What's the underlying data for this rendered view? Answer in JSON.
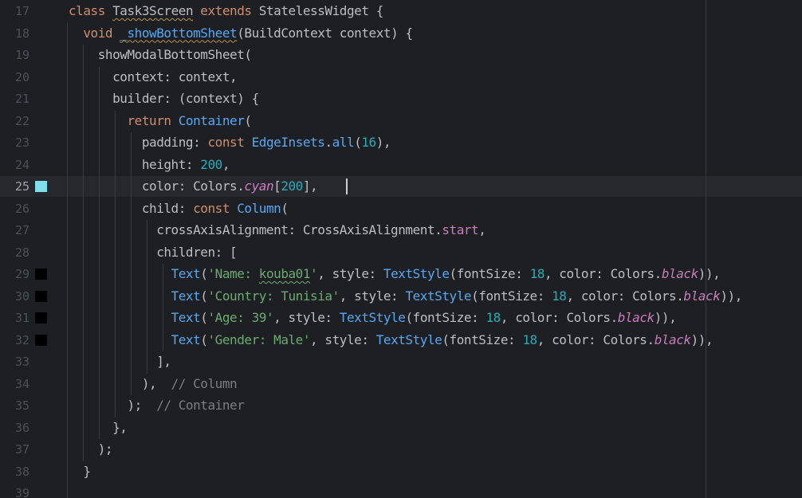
{
  "editor": {
    "current_line": "25",
    "lines": [
      {
        "num": "17",
        "tokens": [
          [
            "kw",
            "class "
          ],
          [
            "squig",
            "Task3Screen"
          ],
          [
            "kw",
            " extends "
          ],
          [
            "plain",
            "StatelessWidget {"
          ]
        ]
      },
      {
        "num": "18",
        "tokens": [
          [
            "plain",
            "  "
          ],
          [
            "kw",
            "void "
          ],
          [
            "fn-sq",
            "_showBottomSheet"
          ],
          [
            "plain",
            "(BuildContext context) {"
          ]
        ]
      },
      {
        "num": "19",
        "tokens": [
          [
            "plain",
            "    showModalBottomSheet("
          ]
        ]
      },
      {
        "num": "20",
        "tokens": [
          [
            "plain",
            "      context: context,"
          ]
        ]
      },
      {
        "num": "21",
        "tokens": [
          [
            "plain",
            "      builder: (context) {"
          ]
        ]
      },
      {
        "num": "22",
        "tokens": [
          [
            "plain",
            "        "
          ],
          [
            "kw",
            "return "
          ],
          [
            "cls",
            "Container"
          ],
          [
            "plain",
            "("
          ]
        ]
      },
      {
        "num": "23",
        "tokens": [
          [
            "plain",
            "          padding: "
          ],
          [
            "kw",
            "const "
          ],
          [
            "cls",
            "EdgeInsets"
          ],
          [
            "plain",
            "."
          ],
          [
            "fn",
            "all"
          ],
          [
            "plain",
            "("
          ],
          [
            "num",
            "16"
          ],
          [
            "plain",
            "),"
          ]
        ]
      },
      {
        "num": "24",
        "tokens": [
          [
            "plain",
            "          height: "
          ],
          [
            "num",
            "200"
          ],
          [
            "plain",
            ","
          ]
        ]
      },
      {
        "num": "25",
        "tokens": [
          [
            "plain",
            "          color: Colors."
          ],
          [
            "field",
            "cyan"
          ],
          [
            "plain",
            "["
          ],
          [
            "num",
            "200"
          ],
          [
            "plain",
            "],"
          ]
        ]
      },
      {
        "num": "26",
        "tokens": [
          [
            "plain",
            "          child: "
          ],
          [
            "kw",
            "const "
          ],
          [
            "cls",
            "Column"
          ],
          [
            "plain",
            "("
          ]
        ]
      },
      {
        "num": "27",
        "tokens": [
          [
            "plain",
            "            crossAxisAlignment: CrossAxisAlignment."
          ],
          [
            "fieldn",
            "start"
          ],
          [
            "plain",
            ","
          ]
        ]
      },
      {
        "num": "28",
        "tokens": [
          [
            "plain",
            "            children: ["
          ]
        ]
      },
      {
        "num": "29",
        "tokens": [
          [
            "plain",
            "              "
          ],
          [
            "cls",
            "Text"
          ],
          [
            "plain",
            "("
          ],
          [
            "str",
            "'Name: "
          ],
          [
            "str-sq",
            "kouba01"
          ],
          [
            "str",
            "'"
          ],
          [
            "plain",
            ", style: "
          ],
          [
            "cls",
            "TextStyle"
          ],
          [
            "plain",
            "(fontSize: "
          ],
          [
            "num",
            "18"
          ],
          [
            "plain",
            ", color: Colors."
          ],
          [
            "field",
            "black"
          ],
          [
            "plain",
            ")),"
          ]
        ]
      },
      {
        "num": "30",
        "tokens": [
          [
            "plain",
            "              "
          ],
          [
            "cls",
            "Text"
          ],
          [
            "plain",
            "("
          ],
          [
            "str",
            "'Country: Tunisia'"
          ],
          [
            "plain",
            ", style: "
          ],
          [
            "cls",
            "TextStyle"
          ],
          [
            "plain",
            "(fontSize: "
          ],
          [
            "num",
            "18"
          ],
          [
            "plain",
            ", color: Colors."
          ],
          [
            "field",
            "black"
          ],
          [
            "plain",
            ")),"
          ]
        ]
      },
      {
        "num": "31",
        "tokens": [
          [
            "plain",
            "              "
          ],
          [
            "cls",
            "Text"
          ],
          [
            "plain",
            "("
          ],
          [
            "str",
            "'Age: 39'"
          ],
          [
            "plain",
            ", style: "
          ],
          [
            "cls",
            "TextStyle"
          ],
          [
            "plain",
            "(fontSize: "
          ],
          [
            "num",
            "18"
          ],
          [
            "plain",
            ", color: Colors."
          ],
          [
            "field",
            "black"
          ],
          [
            "plain",
            ")),"
          ]
        ]
      },
      {
        "num": "32",
        "tokens": [
          [
            "plain",
            "              "
          ],
          [
            "cls",
            "Text"
          ],
          [
            "plain",
            "("
          ],
          [
            "str",
            "'Gender: Male'"
          ],
          [
            "plain",
            ", style: "
          ],
          [
            "cls",
            "TextStyle"
          ],
          [
            "plain",
            "(fontSize: "
          ],
          [
            "num",
            "18"
          ],
          [
            "plain",
            ", color: Colors."
          ],
          [
            "field",
            "black"
          ],
          [
            "plain",
            ")),"
          ]
        ]
      },
      {
        "num": "33",
        "tokens": [
          [
            "plain",
            "            ],"
          ]
        ]
      },
      {
        "num": "34",
        "tokens": [
          [
            "plain",
            "          ),  "
          ],
          [
            "cmt",
            "// Column"
          ]
        ]
      },
      {
        "num": "35",
        "tokens": [
          [
            "plain",
            "        );  "
          ],
          [
            "cmt",
            "// Container"
          ]
        ]
      },
      {
        "num": "36",
        "tokens": [
          [
            "plain",
            "      },"
          ]
        ]
      },
      {
        "num": "37",
        "tokens": [
          [
            "plain",
            "    );"
          ]
        ]
      },
      {
        "num": "38",
        "tokens": [
          [
            "plain",
            "  }"
          ]
        ]
      },
      {
        "num": "39",
        "tokens": []
      }
    ],
    "swatches": {
      "25": "#80deea",
      "29": "#000000",
      "30": "#000000",
      "31": "#000000",
      "32": "#000000"
    },
    "colors": {
      "background": "#1e1f22",
      "keyword": "#cf8e6d",
      "function": "#56a8f5",
      "number": "#2aacb8",
      "string": "#6aab73",
      "field": "#c77dbb",
      "comment": "#7a7e85",
      "text": "#bcbec4"
    }
  }
}
